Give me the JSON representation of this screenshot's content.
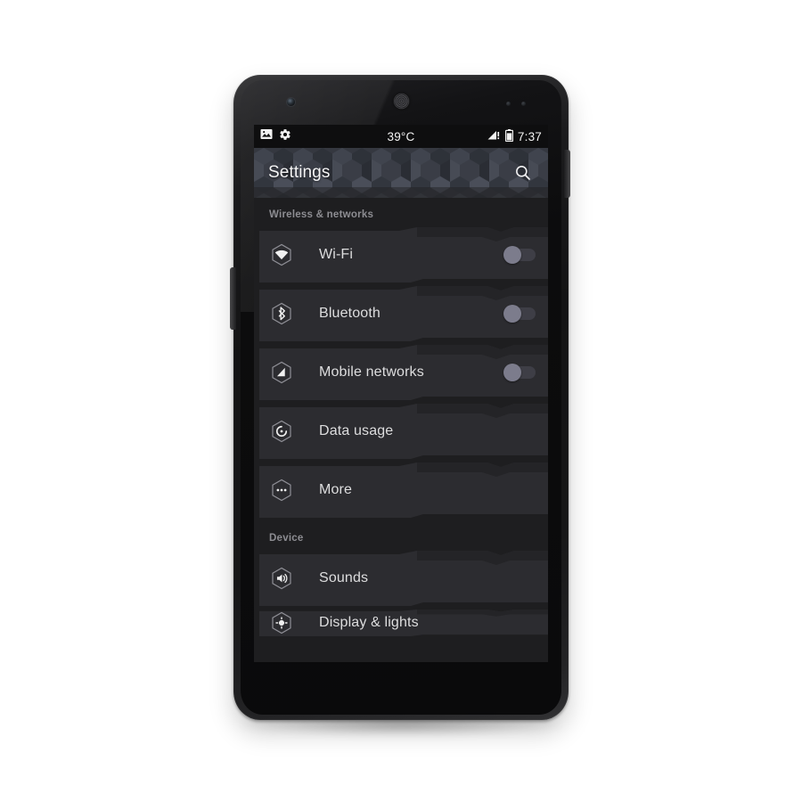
{
  "device": {
    "name": "android-phone",
    "hardware": {
      "front_camera": "camera-icon",
      "earpiece": "speaker-grille",
      "proximity_sensor": "sensor-dot",
      "light_sensor": "sensor-dot",
      "volume_button": "volume-rocker",
      "power_button": "power-button"
    }
  },
  "colors": {
    "screen_background": "#1e1e20",
    "row_background": "#2c2c30",
    "row_background_dark": "#252528",
    "actionbar_base": "#3c3f48",
    "statusbar_background": "#0e0e0f",
    "primary_text": "#ddddde",
    "section_text": "#8d8d92",
    "toggle_thumb": "#7c7c8c",
    "toggle_track": "#3e3e46",
    "icon_stroke": "#8e8e95",
    "icon_fill": "#f0f0f0"
  },
  "statusbar": {
    "left_icons": [
      {
        "name": "screenshot-icon",
        "glyph": "image"
      },
      {
        "name": "settings-gear-icon",
        "glyph": "gear"
      }
    ],
    "temperature": "39°C",
    "right_icons": [
      {
        "name": "signal-icon",
        "glyph": "signal-warning"
      },
      {
        "name": "battery-icon",
        "glyph": "battery"
      }
    ],
    "time": "7:37"
  },
  "actionbar": {
    "title": "Settings",
    "search_icon": "search-icon"
  },
  "list": {
    "sections": [
      {
        "label": "Wireless & networks",
        "items": [
          {
            "label": "Wi-Fi",
            "icon": "wifi-icon",
            "toggle": true,
            "toggle_state": "off"
          },
          {
            "label": "Bluetooth",
            "icon": "bluetooth-icon",
            "toggle": true,
            "toggle_state": "off"
          },
          {
            "label": "Mobile networks",
            "icon": "mobile-network-icon",
            "toggle": true,
            "toggle_state": "off"
          },
          {
            "label": "Data usage",
            "icon": "data-usage-icon",
            "toggle": false,
            "toggle_state": ""
          },
          {
            "label": "More",
            "icon": "more-icon",
            "toggle": false,
            "toggle_state": ""
          }
        ]
      },
      {
        "label": "Device",
        "items": [
          {
            "label": "Sounds",
            "icon": "sound-icon",
            "toggle": false,
            "toggle_state": ""
          },
          {
            "label": "Display & lights",
            "icon": "display-icon",
            "toggle": false,
            "toggle_state": ""
          }
        ]
      }
    ]
  }
}
